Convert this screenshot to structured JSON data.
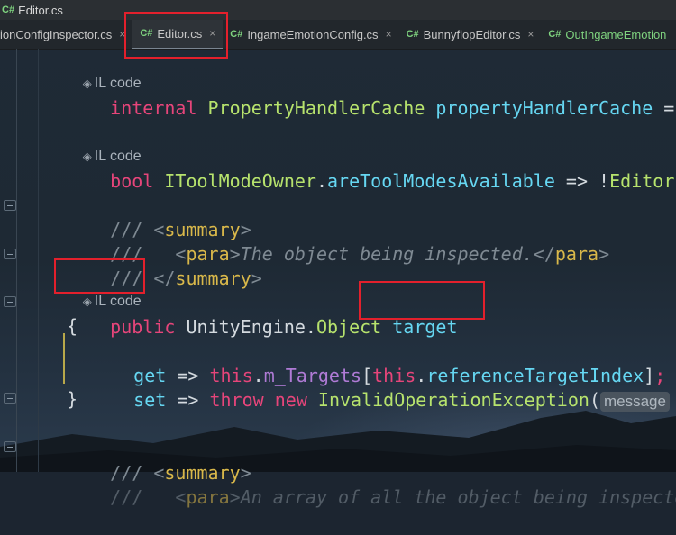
{
  "window": {
    "file_badge": "C#",
    "title": "Editor.cs"
  },
  "tabs": [
    {
      "badge": "",
      "label": "ionConfigInspector.cs",
      "closable": true,
      "active": false,
      "modified": false
    },
    {
      "badge": "C#",
      "label": "Editor.cs",
      "closable": true,
      "active": true,
      "modified": false
    },
    {
      "badge": "C#",
      "label": "IngameEmotionConfig.cs",
      "closable": true,
      "active": false,
      "modified": false
    },
    {
      "badge": "C#",
      "label": "BunnyflopEditor.cs",
      "closable": true,
      "active": false,
      "modified": false
    },
    {
      "badge": "C#",
      "label": "OutIngameEmotion",
      "closable": false,
      "active": false,
      "modified": true
    }
  ],
  "close_glyph": "×",
  "il_marker": "IL code",
  "code": {
    "l1_kw": "internal",
    "l1_type": "PropertyHandlerCache",
    "l1_name": "propertyHandlerCache",
    "l1_rest": " =",
    "l2_kw": "bool",
    "l2_iface": "IToolModeOwner",
    "l2_dot": ".",
    "l2_prop": "areToolModesAvailable",
    "l2_rest": " => !",
    "l2_tail": "Editor",
    "doc1_open": "/// <",
    "doc1_tag": "summary",
    "doc1_close": ">",
    "doc2_lead": "///   <",
    "doc2_tag": "para",
    "doc2_gt": ">",
    "doc2_text": "The object being inspected.",
    "doc2_end_lt": "</",
    "doc2_end_tag": "para",
    "doc2_end_gt": ">",
    "doc3_open": "/// </",
    "doc3_tag": "summary",
    "doc3_close": ">",
    "decl_kw": "public",
    "decl_ns": "UnityEngine",
    "decl_dot": ".",
    "decl_type": "Object",
    "decl_name": "target",
    "open_brace": "{",
    "get_kw": "get",
    "get_arrow": " => ",
    "get_this": "this",
    "get_dot": ".",
    "get_field": "m_Targets",
    "get_lb": "[",
    "get_this2": "this",
    "get_dot2": ".",
    "get_prop": "referenceTargetIndex",
    "get_rb": "]",
    "get_semi": ";",
    "set_kw": "set",
    "set_arrow": " => ",
    "set_throw": "throw",
    "set_new": "new",
    "set_type": "InvalidOperationException",
    "set_paren": "(",
    "set_hint": "message",
    "close_brace": "}",
    "doc4_open": "/// <",
    "doc4_tag": "summary",
    "doc4_close": ">",
    "doc5_lead": "///   <",
    "doc5_tag": "para",
    "doc5_gt": ">",
    "doc5_text": "An array of all the object being inspecte"
  },
  "colors": {
    "highlight": "#e3202c",
    "keyword": "#e6457a",
    "type": "#b7e36d",
    "property": "#66d7f2",
    "field": "#b07bd6",
    "comment": "#7f8a93",
    "doc_tag": "#d9b84a"
  }
}
